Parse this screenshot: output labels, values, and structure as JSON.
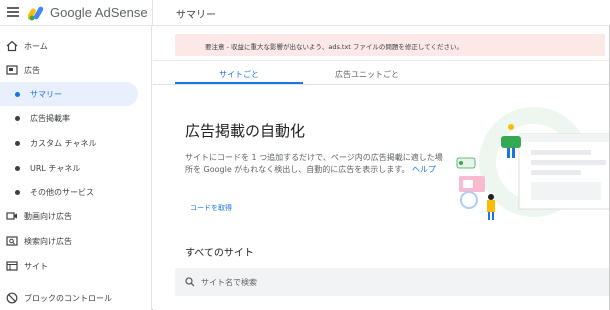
{
  "header": {
    "brand": "Google AdSense",
    "page_title": "サマリー"
  },
  "sidebar": {
    "items": [
      {
        "label": "ホーム",
        "icon": "home-icon"
      },
      {
        "label": "広告",
        "icon": "ads-icon"
      },
      {
        "label": "サマリー"
      },
      {
        "label": "広告掲載率"
      },
      {
        "label": "カスタム チャネル"
      },
      {
        "label": "URL チャネル"
      },
      {
        "label": "その他のサービス"
      },
      {
        "label": "動画向け広告",
        "icon": "video-icon"
      },
      {
        "label": "検索向け広告",
        "icon": "search-ads-icon"
      },
      {
        "label": "サイト",
        "icon": "sites-icon"
      },
      {
        "label": "ブロックのコントロール",
        "icon": "block-icon"
      }
    ]
  },
  "alert": {
    "text": "要注意 - 収益に重大な影響が出ないよう、ads.txt ファイルの問題を修正してください。"
  },
  "tabs": [
    {
      "label": "サイトごと"
    },
    {
      "label": "広告ユニットごと"
    }
  ],
  "hero": {
    "title": "広告掲載の自動化",
    "description": "サイトにコードを 1 つ追加するだけで、ページ内の広告掲載に適した場所を Google がもれなく検出し、自動的に広告を表示します。",
    "help": "ヘルプ",
    "get_code": "コードを取得"
  },
  "sites": {
    "title": "すべてのサイト",
    "search_placeholder": "サイト名で検索"
  },
  "colors": {
    "accent": "#1a73e8",
    "alert_bg": "#fce8e6",
    "active_bg": "#e8f0fe"
  }
}
